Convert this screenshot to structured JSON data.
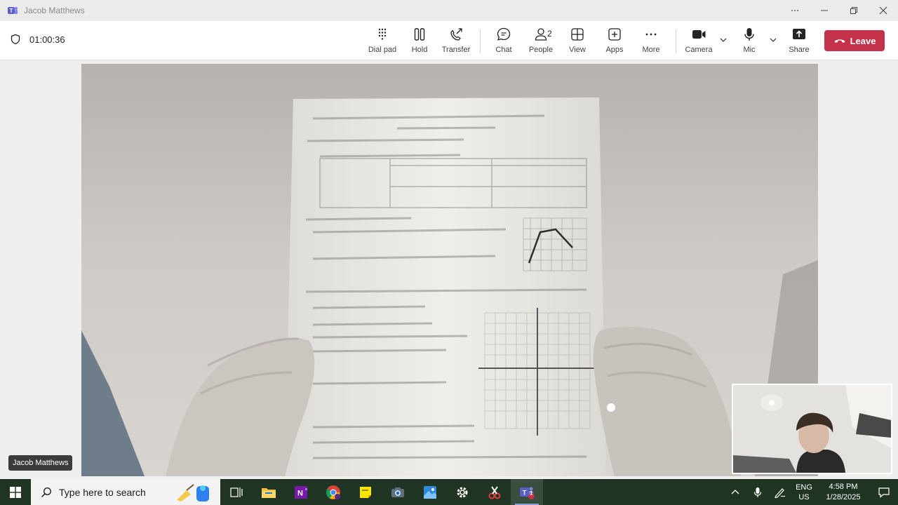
{
  "window": {
    "title": "Jacob Matthews"
  },
  "call": {
    "timer": "01:00:36"
  },
  "toolbar": {
    "dial_pad": "Dial pad",
    "hold": "Hold",
    "transfer": "Transfer",
    "chat": "Chat",
    "people": "People",
    "people_count": "2",
    "view": "View",
    "apps": "Apps",
    "more": "More",
    "camera": "Camera",
    "mic": "Mic",
    "share": "Share",
    "leave": "Leave"
  },
  "stage": {
    "participant_name": "Jacob Matthews"
  },
  "taskbar": {
    "search_placeholder": "Type here to search",
    "apps": [
      "task-view",
      "file-explorer",
      "onenote",
      "chrome",
      "sticky-notes",
      "camera",
      "paint",
      "settings",
      "snipping-tool",
      "teams"
    ],
    "teams_badge": "1",
    "language": "ENG",
    "region": "US",
    "time": "4:58 PM",
    "date": "1/28/2025"
  },
  "colors": {
    "leave_red": "#c4314b",
    "taskbar_bg": "#1f3423",
    "teams_purple": "#5b5fc7"
  }
}
